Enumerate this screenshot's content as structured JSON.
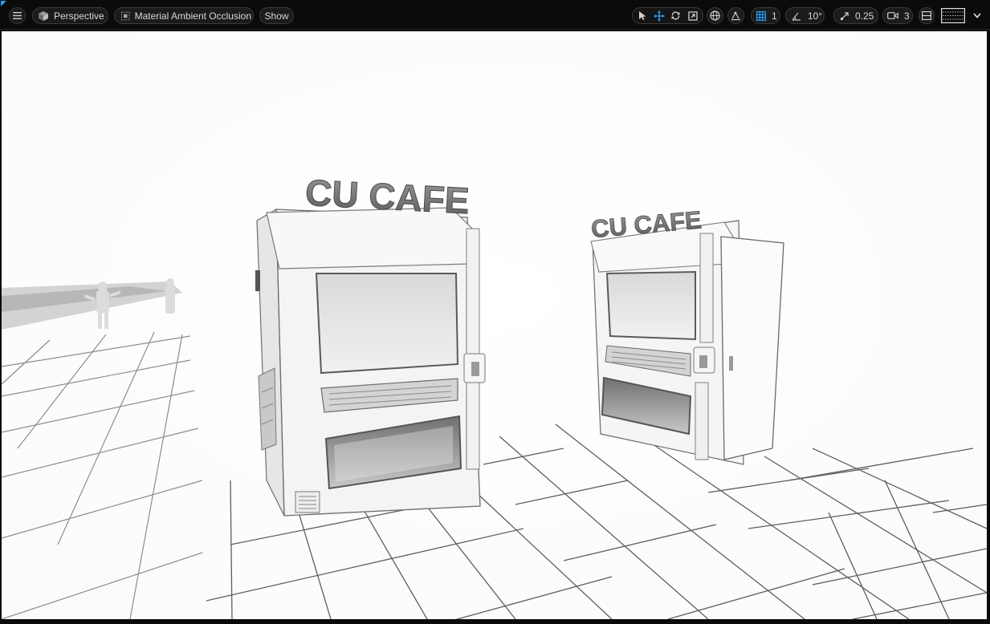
{
  "toolbar": {
    "menu_icon": "hamburger-menu-icon",
    "view_mode": "Perspective",
    "buffer_mode": "Material Ambient Occlusion",
    "show_label": "Show",
    "grid_snap_value": "1",
    "rotation_snap_value": "10°",
    "scale_snap_value": "0.25",
    "camera_speed_value": "3",
    "accent_color": "#2a9df4"
  },
  "scene": {
    "sign_left": "CU CAFE",
    "sign_right": "CU CAFE"
  }
}
